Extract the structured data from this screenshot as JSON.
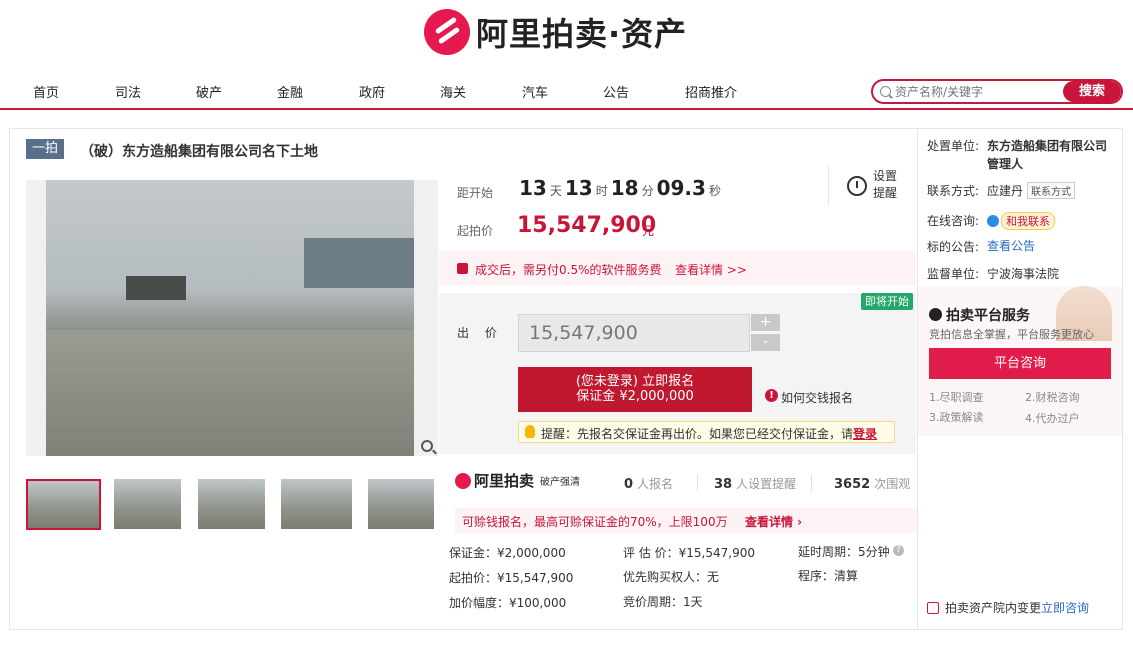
{
  "brand": {
    "title": "阿里拍卖·资产"
  },
  "nav": {
    "items": [
      "首页",
      "司法",
      "破产",
      "金融",
      "政府",
      "海关",
      "汽车",
      "公告",
      "招商推介"
    ]
  },
  "search": {
    "placeholder": "资产名称/关键字",
    "button": "搜索"
  },
  "item": {
    "round": "一拍",
    "title": "（破）东方造船集团有限公司名下土地"
  },
  "auction": {
    "countdown_label": "距开始",
    "days": "13",
    "days_unit": "天",
    "hours": "13",
    "hours_unit": "时",
    "minutes": "18",
    "minutes_unit": "分",
    "seconds": "09.3",
    "seconds_unit": "秒",
    "reminder": "设置提醒",
    "start_price_label": "起拍价",
    "start_price": "15,547,900",
    "start_price_unit": "元",
    "fee_text": "成交后，需另付0.5%的软件服务费",
    "fee_link": "查看详情 >>",
    "soon_badge": "即将开始",
    "bid_label": "出 价",
    "bid_value": "15,547,900",
    "plus": "+",
    "minus": "-",
    "apply_line1": "(您未登录) 立即报名",
    "apply_line2": "保证金 ¥2,000,000",
    "how_link": "如何交钱报名",
    "tip_text": "提醒：先报名交保证金再出价。如果您已经交付保证金，请",
    "tip_login": "登录"
  },
  "stats": {
    "brand": "阿里拍卖",
    "brand_tag": "破产强清",
    "signups": "0",
    "signups_label": "人报名",
    "reminders": "38",
    "reminders_label": "人设置提醒",
    "views": "3652",
    "views_label": "次围观"
  },
  "credit": {
    "text": "可赊钱报名，最高可赊保证金的70%，上限100万",
    "link": "查看详情 ›"
  },
  "details": {
    "deposit": "保证金：¥2,000,000",
    "appraisal": "评 估 价：¥15,547,900",
    "delay": "延时周期：5分钟",
    "start": "起拍价：¥15,547,900",
    "priority": "优先购买权人",
    "priority_value": "：无",
    "procedure": "程序：清算",
    "increment": "加价幅度：¥100,000",
    "cycle": "竞价周期：1天"
  },
  "seller": {
    "unit_label": "处置单位:",
    "unit_value_1": "东方造船集团有限公司",
    "unit_value_2": "管理人",
    "contact_label": "联系方式:",
    "contact_name": "应建丹",
    "contact_btn": "联系方式",
    "chat_label": "在线咨询:",
    "chat_btn": "和我联系",
    "notice_label": "标的公告:",
    "notice_link": "查看公告",
    "supervisor_label": "监督单位:",
    "supervisor_value": "宁波海事法院"
  },
  "service": {
    "title": "拍卖平台服务",
    "subtitle": "竞拍信息全掌握，平台服务更放心",
    "button": "平台咨询",
    "items": [
      "1.尽职调查",
      "2.财税咨询",
      "3.政策解读",
      "4.代办过户"
    ]
  },
  "footer": {
    "text": "拍卖资产院内变更",
    "link": "立即咨询"
  }
}
